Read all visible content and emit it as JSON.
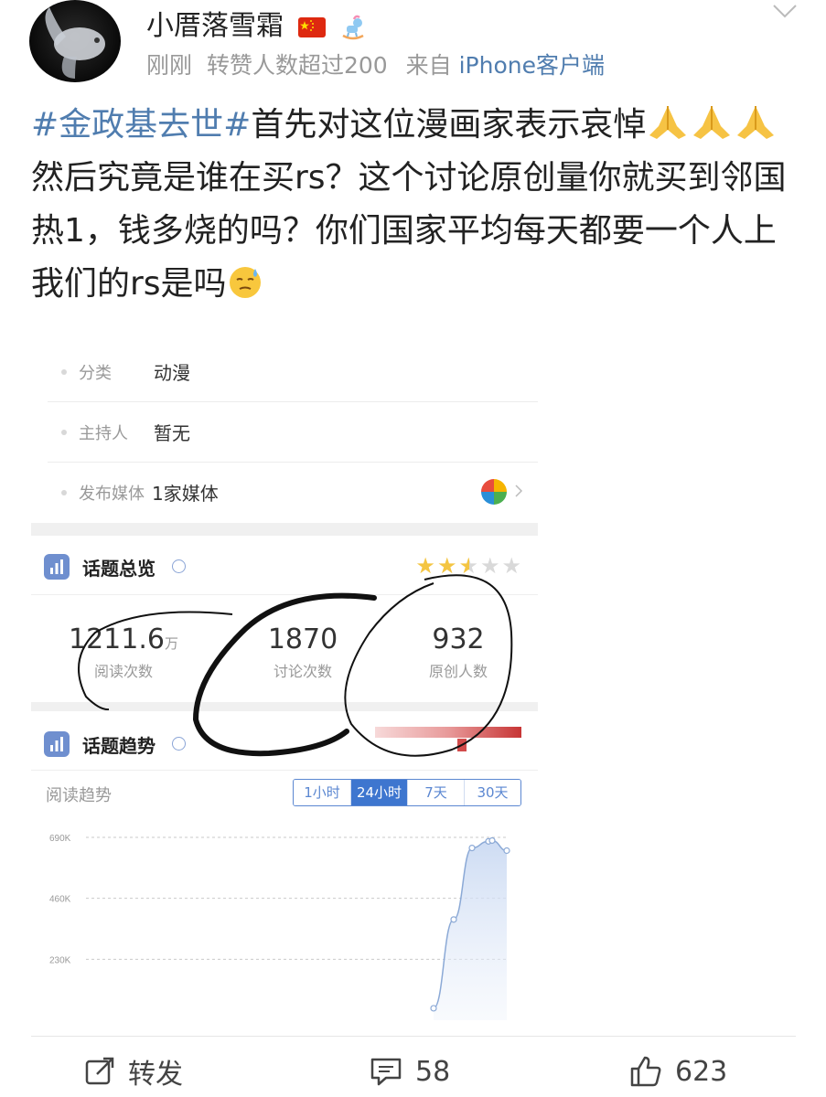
{
  "post": {
    "username": "小厝落雪霜",
    "time": "刚刚",
    "reposts_note": "转赞人数超过200",
    "source_prefix": "来自",
    "source": "iPhone客户端",
    "hashtag": "#金政基去世#",
    "text_1": "首先对这位漫画家表示哀悼",
    "text_2": "然后究竟是谁在买rs？这个讨论原创量你就买到邻国热1，钱多烧的吗？你们国家平均每天都要一个人上我们的rs是吗"
  },
  "topic": {
    "rows": [
      {
        "label": "分类",
        "value": "动漫"
      },
      {
        "label": "主持人",
        "value": "暂无"
      },
      {
        "label": "发布媒体",
        "value": "1家媒体"
      }
    ],
    "overview_title": "话题总览",
    "rating_stars": 2.5,
    "stats": [
      {
        "value": "1211.6",
        "unit": "万",
        "caption": "阅读次数"
      },
      {
        "value": "1870",
        "unit": "",
        "caption": "讨论次数"
      },
      {
        "value": "932",
        "unit": "",
        "caption": "原创人数"
      }
    ],
    "trend_title": "话题趋势",
    "trend_label": "阅读趋势",
    "ranges": [
      "1小时",
      "24小时",
      "7天",
      "30天"
    ],
    "active_range": "24小时"
  },
  "chart_data": {
    "type": "area",
    "y_ticks": [
      "690K",
      "460K",
      "230K"
    ],
    "ylim": [
      0,
      690
    ],
    "y_unit": "K",
    "values": [
      45,
      380,
      650,
      675,
      678,
      640
    ],
    "grid": "dashed horizontal"
  },
  "actions": {
    "repost": "转发",
    "comments": "58",
    "likes": "623"
  },
  "colors": {
    "link": "#507daf",
    "accent": "#3e76cf",
    "star": "#f4c542",
    "heat": "#c73535"
  }
}
